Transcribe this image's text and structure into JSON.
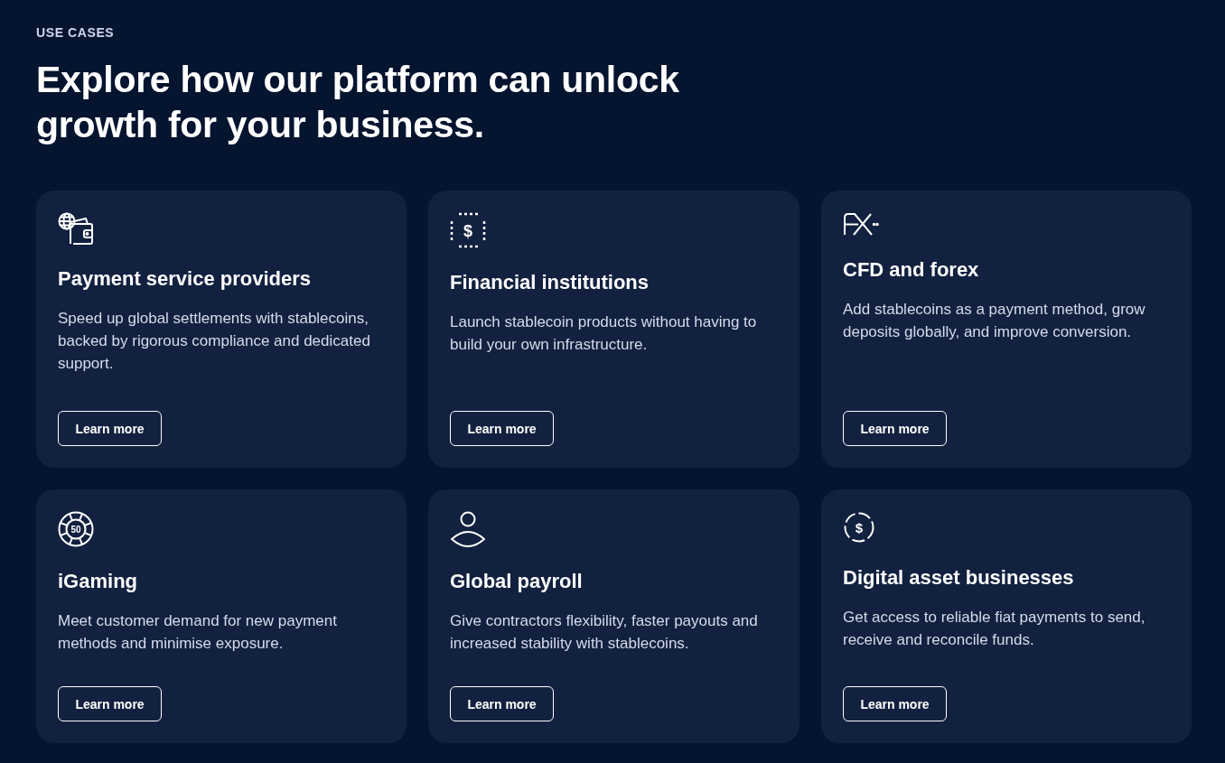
{
  "eyebrow": "USE CASES",
  "heading": "Explore how our platform can unlock growth for your business.",
  "cards": [
    {
      "title": "Payment service providers",
      "description": "Speed up global settlements with stablecoins, backed by rigorous compliance and dedicated support.",
      "button": "Learn more"
    },
    {
      "title": "Financial institutions",
      "icon_label": "$",
      "description": "Launch stablecoin products without having to build your own infrastructure.",
      "button": "Learn more"
    },
    {
      "title": "CFD and forex",
      "description": "Add stablecoins as a payment method, grow deposits globally, and improve conversion.",
      "button": "Learn more"
    },
    {
      "title": "iGaming",
      "icon_label": "50",
      "description": "Meet customer demand for new payment methods and minimise exposure.",
      "button": "Learn more"
    },
    {
      "title": "Global payroll",
      "description": "Give contractors flexibility, faster payouts and increased stability with stablecoins.",
      "button": "Learn more"
    },
    {
      "title": "Digital asset businesses",
      "icon_label": "$",
      "description": "Get access to reliable fiat payments to send, receive and reconcile funds.",
      "button": "Learn more"
    }
  ]
}
